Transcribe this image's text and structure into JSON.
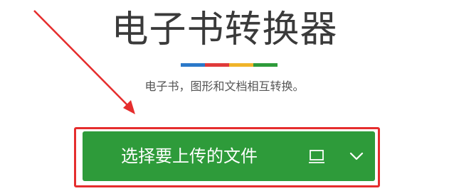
{
  "header": {
    "title": "电子书转换器",
    "subtitle": "电子书，图形和文档相互转换。"
  },
  "brand_colors": [
    "#2b79c9",
    "#e03a3a",
    "#f0b429",
    "#2e9b3a"
  ],
  "upload": {
    "label": "选择要上传的文件",
    "source_icon": "device-icon",
    "dropdown_icon": "chevron-down-icon",
    "button_color": "#2e9b3a"
  },
  "annotation": {
    "color": "#e52d2d"
  }
}
